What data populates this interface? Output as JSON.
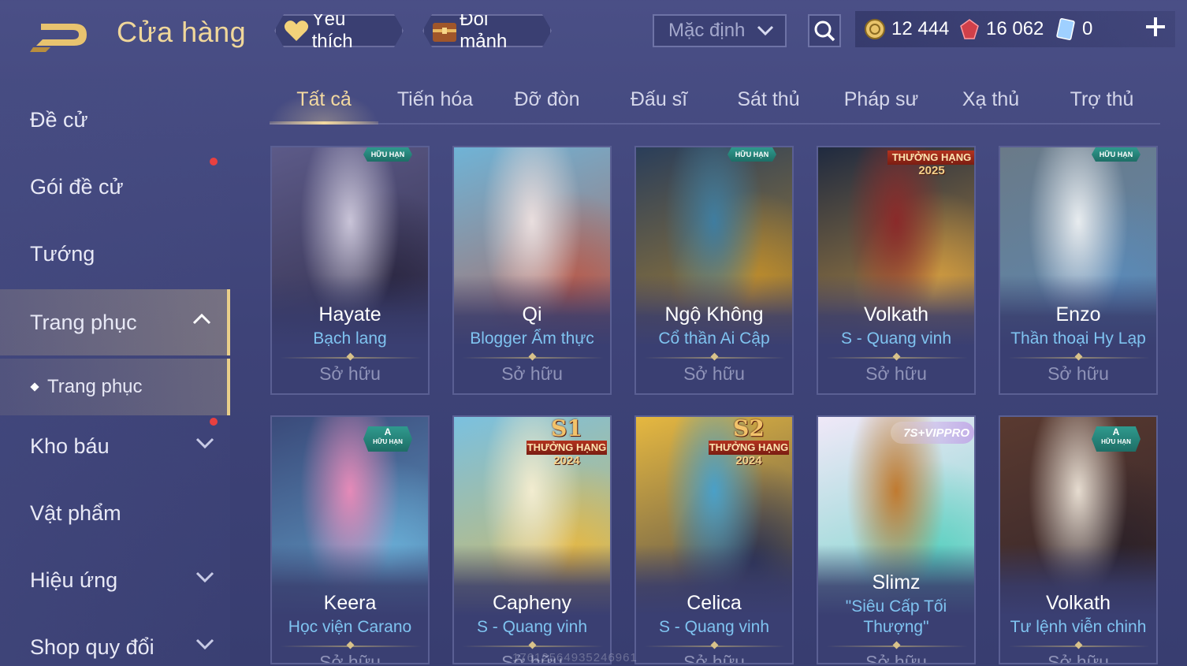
{
  "header": {
    "title": "Cửa hàng",
    "favorites_label": "Yêu thích",
    "exchange_shards_label": "Đổi mảnh",
    "sort_selected": "Mặc định",
    "currencies": {
      "gold": "12 444",
      "ruby": "16 062",
      "voucher": "0"
    }
  },
  "sidebar": {
    "items": [
      {
        "label": "Đề cử"
      },
      {
        "label": "Gói đề cử"
      },
      {
        "label": "Tướng"
      },
      {
        "label": "Trang phục"
      },
      {
        "label": "Trang phục"
      },
      {
        "label": "Kho báu"
      },
      {
        "label": "Vật phẩm"
      },
      {
        "label": "Hiệu ứng"
      },
      {
        "label": "Shop quy đổi"
      }
    ]
  },
  "tabs": [
    {
      "label": "Tất cả"
    },
    {
      "label": "Tiến hóa"
    },
    {
      "label": "Đỡ đòn"
    },
    {
      "label": "Đấu sĩ"
    },
    {
      "label": "Sát thủ"
    },
    {
      "label": "Pháp sư"
    },
    {
      "label": "Xạ thủ"
    },
    {
      "label": "Trợ thủ"
    }
  ],
  "cards": [
    {
      "hero": "Hayate",
      "skin": "Bạch lang",
      "status": "Sở hữu",
      "badge": "HỮU HẠN",
      "colors": [
        "#5c5a88",
        "#c9c4d8",
        "#2a2640"
      ]
    },
    {
      "hero": "Qi",
      "skin": "Blogger Ẩm thực",
      "status": "Sở hữu",
      "badge": "",
      "colors": [
        "#6fb3d6",
        "#e9dede",
        "#b85a4a"
      ]
    },
    {
      "hero": "Ngộ Không",
      "skin": "Cổ thần Ai Cập",
      "status": "Sở hữu",
      "badge": "HỮU HẠN",
      "colors": [
        "#2a3e5a",
        "#3f7da0",
        "#c4902a"
      ]
    },
    {
      "hero": "Volkath",
      "skin": "S - Quang vinh",
      "status": "Sở hữu",
      "badge": "THƯỞNG HẠNG",
      "badge_year": "2025",
      "colors": [
        "#1f2a40",
        "#8a2a2a",
        "#d8a040"
      ]
    },
    {
      "hero": "Enzo",
      "skin": "Thần thoại Hy Lạp",
      "status": "Sở hữu",
      "badge": "HỮU HẠN",
      "colors": [
        "#6a7a88",
        "#e8ecef",
        "#5a8ab8"
      ]
    },
    {
      "hero": "Keera",
      "skin": "Học viện Carano",
      "status": "Sở hữu",
      "badge": "HỮU HẠN",
      "badge_tier": "A",
      "colors": [
        "#3a4a7a",
        "#e58ab8",
        "#6ab0d8"
      ]
    },
    {
      "hero": "Capheny",
      "skin": "S - Quang vinh",
      "status": "Sở hữu",
      "badge": "THƯỞNG HẠNG",
      "badge_season": "S1",
      "badge_year": "2024",
      "colors": [
        "#7ac0e0",
        "#f2ecd0",
        "#e8b840"
      ]
    },
    {
      "hero": "Celica",
      "skin": "S - Quang vinh",
      "status": "Sở hữu",
      "badge": "THƯỞNG HẠNG",
      "badge_season": "S2",
      "badge_year": "2024",
      "colors": [
        "#e6b840",
        "#4aa0c8",
        "#2a3050"
      ]
    },
    {
      "hero": "Slimz",
      "skin": "\"Siêu Cấp Tối Thượng\"",
      "status": "Sở hữu",
      "badge": "7S+VIPPRO",
      "colors": [
        "#f0e8f8",
        "#c07a30",
        "#5ad0c0"
      ]
    },
    {
      "hero": "Volkath",
      "skin": "Tư lệnh viễn chinh",
      "status": "Sở hữu",
      "badge": "HỮU HẠN",
      "badge_tier": "A",
      "colors": [
        "#5a3a30",
        "#e6dcd0",
        "#2a2028"
      ]
    }
  ],
  "watermark": "17612564935246961"
}
